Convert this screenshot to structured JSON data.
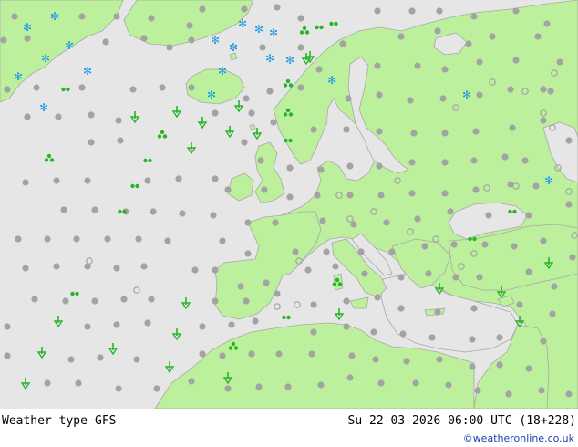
{
  "map": {
    "colors": {
      "sea": "#e6e6e6",
      "land": "#bdf09c",
      "border": "#a8a8a8",
      "cloud": "#a3a3a3",
      "rain": "#28b428",
      "drizzle": "#28b428",
      "snow": "#1e9be6"
    },
    "legend_icons": {
      "cloudy": "gray-dot-icon",
      "rain": "rain-shower-icon",
      "light-rain": "drizzle-icon",
      "snow": "snowflake-icon",
      "showers": "shower-cluster-icon"
    }
  },
  "footer": {
    "title": "Weather type",
    "model": "GFS",
    "datetime": "Su 22-03-2026 06:00 UTC (18+228)",
    "credit": "©weatheronline.co.uk"
  }
}
